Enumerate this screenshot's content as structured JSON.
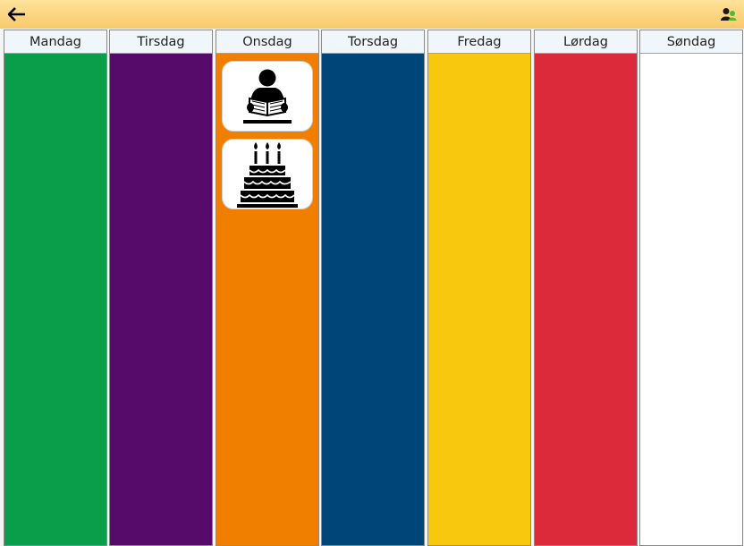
{
  "toolbar": {
    "back_icon": "arrow-left-icon",
    "user_icon": "user-switch-icon",
    "background": "#f9c96a"
  },
  "days": [
    {
      "label": "Mandag",
      "color": "#0a9e4a"
    },
    {
      "label": "Tirsdag",
      "color": "#560b6a"
    },
    {
      "label": "Onsdag",
      "color": "#f07f00"
    },
    {
      "label": "Torsdag",
      "color": "#004578"
    },
    {
      "label": "Fredag",
      "color": "#f8c80e"
    },
    {
      "label": "Lørdag",
      "color": "#dd2a3b"
    },
    {
      "label": "Søndag",
      "color": "#ffffff"
    }
  ],
  "activities": {
    "onsdag": [
      {
        "icon": "person-reading-icon"
      },
      {
        "icon": "birthday-cake-icon"
      }
    ]
  }
}
